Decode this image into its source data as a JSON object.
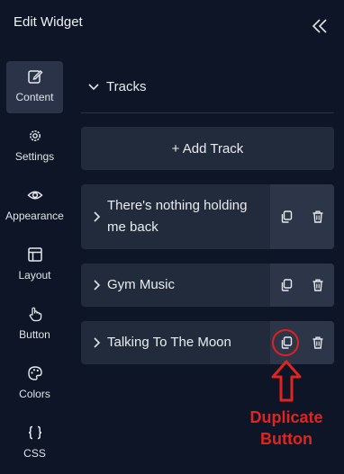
{
  "header": {
    "title": "Edit Widget"
  },
  "sidebar": {
    "items": [
      {
        "label": "Content",
        "icon": "edit-icon",
        "active": true
      },
      {
        "label": "Settings",
        "icon": "gear-icon",
        "active": false
      },
      {
        "label": "Appearance",
        "icon": "eye-icon",
        "active": false
      },
      {
        "label": "Layout",
        "icon": "layout-icon",
        "active": false
      },
      {
        "label": "Button",
        "icon": "pointer-hand-icon",
        "active": false
      },
      {
        "label": "Colors",
        "icon": "palette-icon",
        "active": false
      },
      {
        "label": "CSS",
        "icon": "braces-icon",
        "active": false
      }
    ]
  },
  "content": {
    "section_title": "Tracks",
    "add_button_label": "+ Add Track",
    "tracks": [
      {
        "name": "There's nothing holding me back"
      },
      {
        "name": "Gym Music"
      },
      {
        "name": "Talking To The Moon"
      }
    ]
  },
  "annotation": {
    "line1": "Duplicate",
    "line2": "Button",
    "color": "#e0241f"
  },
  "colors": {
    "background": "#0e1526",
    "panel": "#222b3b",
    "active_nav": "#2a3347",
    "action_strip": "#2d3648"
  }
}
